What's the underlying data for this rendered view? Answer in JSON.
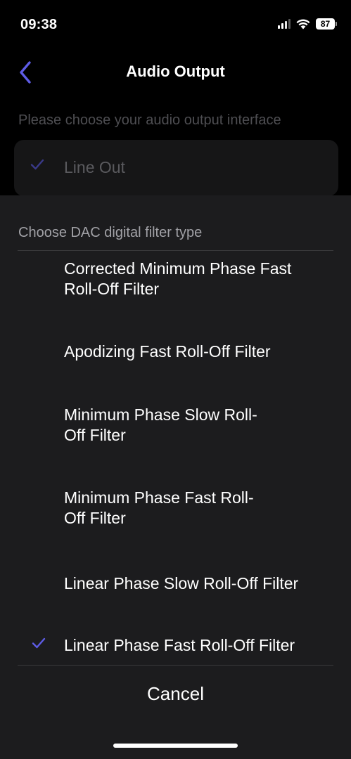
{
  "status_bar": {
    "time": "09:38",
    "battery": "87",
    "icons": [
      "signal-icon",
      "wifi-icon",
      "battery-icon"
    ]
  },
  "nav": {
    "title": "Audio Output",
    "back_icon": "chevron-left-icon"
  },
  "background": {
    "caption": "Please choose your audio output interface",
    "selected_output": "Line Out"
  },
  "sheet": {
    "caption": "Choose DAC digital filter type",
    "options": [
      {
        "line1": "Corrected Minimum Phase Fast",
        "line2": "Roll-Off Filter",
        "selected": false
      },
      {
        "line1": "Apodizing Fast Roll-Off Filter",
        "line2": "",
        "selected": false
      },
      {
        "line1": "Minimum Phase Slow Roll-",
        "line2": "Off Filter",
        "selected": false
      },
      {
        "line1": "Minimum Phase Fast Roll-",
        "line2": "Off Filter",
        "selected": false
      },
      {
        "line1": "Linear Phase Slow Roll-Off Filter",
        "line2": "",
        "selected": false
      },
      {
        "line1": "Linear Phase Fast Roll-Off Filter",
        "line2": "",
        "selected": true
      }
    ],
    "cancel_label": "Cancel"
  },
  "colors": {
    "accent": "#5e5ce6",
    "dim_accent": "#3a3a8a",
    "sheet_bg": "#1c1c1e"
  }
}
